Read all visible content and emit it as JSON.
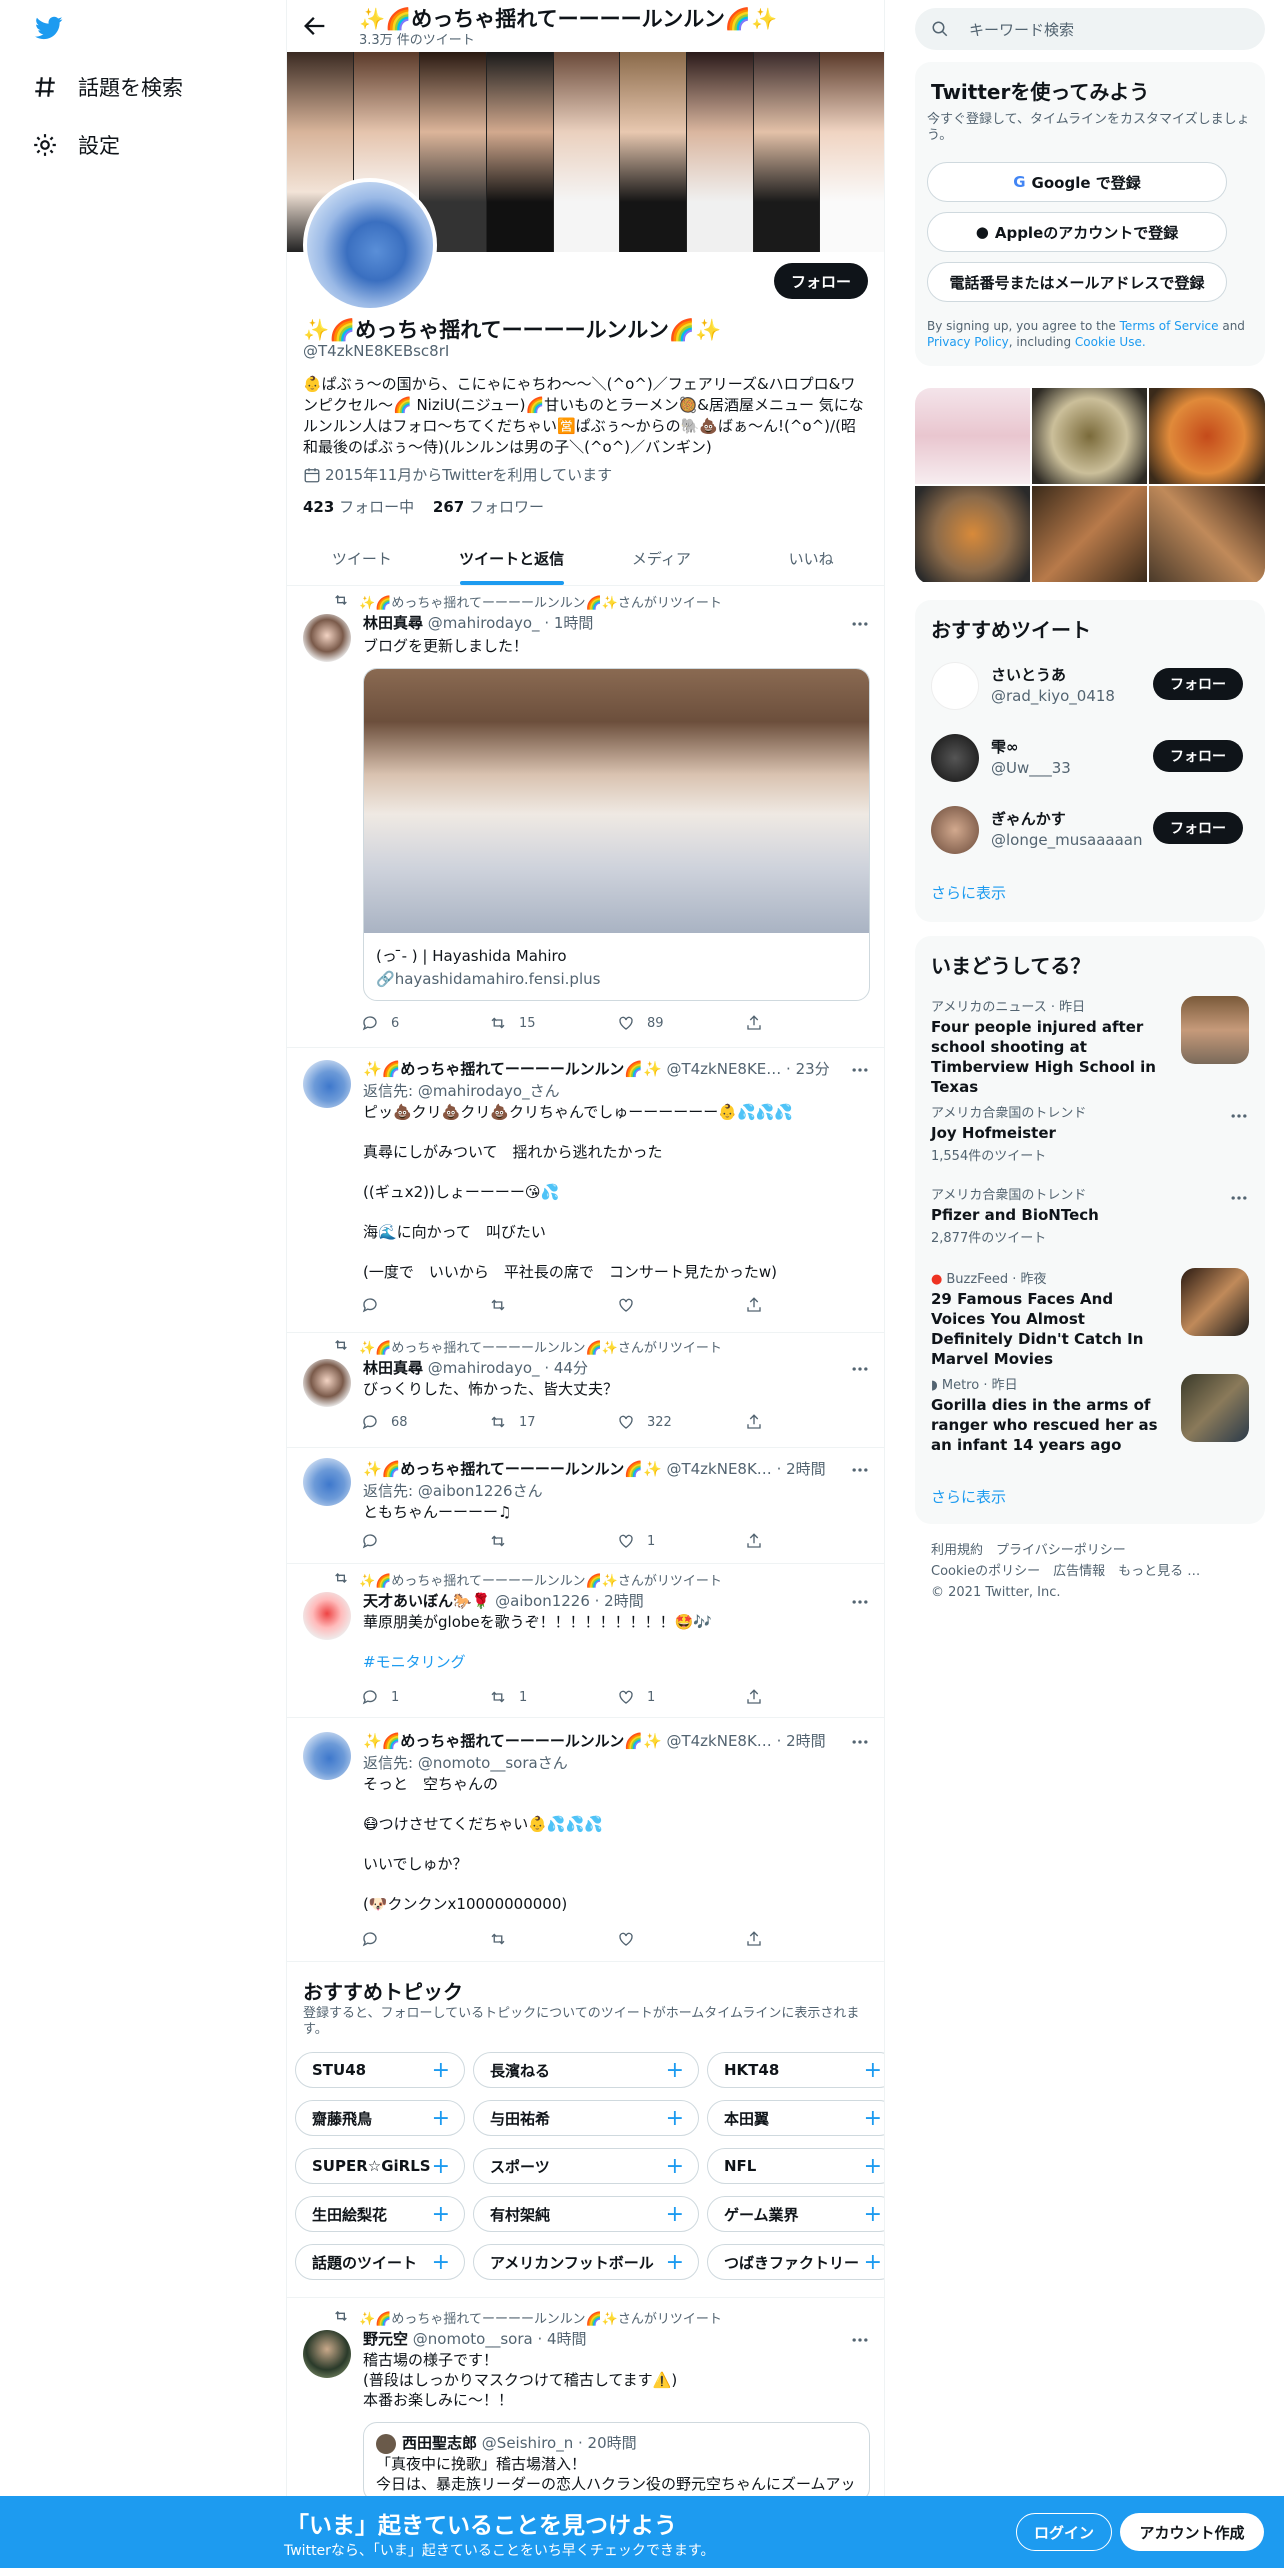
{
  "nav": {
    "explore": "話題を検索",
    "settings": "設定"
  },
  "profile": {
    "name": "✨🌈めっちゃ揺れてーーーールンルン🌈✨",
    "tweet_count": "3.3万 件のツイート",
    "handle": "@T4zkNE8KEBsc8rI",
    "follow": "フォロー",
    "bio": "👶ぱぶぅ〜の国から、こにゃにゃちわ〜〜＼(^o^)／フェアリーズ&ハロプロ&ワンピクセル〜🌈 NiziU(ニジュー)🌈甘いものとラーメン🥘&居酒屋メニュー 気になルンルン人はフォロ〜ちてくだちゃい🈺ぱぶぅ〜からの🐘💩ばぁ〜ん!(^o^)/(昭和最後のぱぶぅ〜侍)(ルンルンは男の子＼(^o^)／バンギン)",
    "joined": "2015年11月からTwitterを利用しています",
    "following_count": "423",
    "following_label": "フォロー中",
    "followers_count": "267",
    "followers_label": "フォロワー"
  },
  "tabs": [
    "ツイート",
    "ツイートと返信",
    "メディア",
    "いいね"
  ],
  "retweet_label": "✨🌈めっちゃ揺れてーーーールンルン🌈✨さんがリツイート",
  "tweets": [
    {
      "name": "林田真尋",
      "meta": "@mahirodayo_ · 1時間",
      "text": "ブログを更新しました！",
      "card_title": "(っ ̄- ) | Hayashida Mahiro",
      "card_url": "hayashidamahiro.fensi.plus",
      "reply": "6",
      "rt": "15",
      "like": "89"
    },
    {
      "name": "✨🌈めっちゃ揺れてーーーールンルン🌈✨",
      "meta": "@T4zkNE8KE… · 23分",
      "reply_to": "返信先: ",
      "reply_handle": "@mahirodayo_",
      "reply_suffix": "さん",
      "text": "ピッ💩クリ💩クリ💩クリちゃんでしゅーーーーーー👶💦💦💦\n\n真尋にしがみついて　揺れから逃れたかった\n\n((ギュx2))しょーーーー😘💦\n\n海🌊に向かって　叫びたい\n\n(一度で　いいから　平社長の席で　コンサート見たかったw)"
    },
    {
      "name": "林田真尋",
      "meta": "@mahirodayo_ · 44分",
      "text": "びっくりした、怖かった、皆大丈夫？",
      "reply": "68",
      "rt": "17",
      "like": "322"
    },
    {
      "name": "✨🌈めっちゃ揺れてーーーールンルン🌈✨",
      "meta": "@T4zkNE8K… · 2時間",
      "reply_to": "返信先: ",
      "reply_handle": "@aibon1226",
      "reply_suffix": "さん",
      "text": "ともちゃんーーーー♫",
      "like": "1"
    },
    {
      "name": "天才あいぼん🐎🌹",
      "meta": "@aibon1226 · 2時間",
      "text": "華原朋美がglobeを歌うぞ！！！！！！！！！🤩🎶",
      "hashtag": "#モニタリング",
      "reply": "1",
      "rt": "1",
      "like": "1"
    },
    {
      "name": "✨🌈めっちゃ揺れてーーーールンルン🌈✨",
      "meta": "@T4zkNE8K… · 2時間",
      "reply_to": "返信先: ",
      "reply_handle": "@nomoto__sora",
      "reply_suffix": "さん",
      "text": "そっと　空ちゃんの\n\n😷つけさせてくだちゃい👶💦💦💦\n\nいいでしゅか？\n\n(🐶クンクンx10000000000)"
    },
    {
      "name": "野元空",
      "meta": "@nomoto__sora · 4時間",
      "text": "稽古場の様子です！\n(普段はしっかりマスクつけて稽古してます⚠️)\n本番お楽しみに〜！！",
      "quote_name": "西田聖志郎",
      "quote_meta": "@Seishiro_n · 20時間",
      "quote_text": "「真夜中に挽歌」稽古場潜入！\n今日は、暴走族リーダーの恋人ハクラン役の野元空ちゃんにズームアップ"
    }
  ],
  "topics": {
    "title": "おすすめトピック",
    "subtitle": "登録すると、フォローしているトピックについてのツイートがホームタイムラインに表示されます。",
    "chips": [
      "STU48",
      "長濱ねる",
      "HKT48",
      "齋藤飛鳥",
      "与田祐希",
      "本田翼",
      "SUPER☆GiRLS",
      "スポーツ",
      "NFL",
      "生田絵梨花",
      "有村架純",
      "ゲーム業界",
      "話題のツイート",
      "アメリカンフットボール",
      "つばきファクトリー"
    ]
  },
  "sidebar": {
    "search_placeholder": "キーワード検索",
    "signup_title": "Twitterを使ってみよう",
    "signup_sub": "今すぐ登録して、タイムラインをカスタマイズしましょう。",
    "google": "Google で登録",
    "apple": "Appleのアカウントで登録",
    "phone": "電話番号またはメールアドレスで登録",
    "terms_pre": "By signing up, you agree to the ",
    "terms": "Terms of Service",
    "terms_mid": " and ",
    "privacy": "Privacy Policy",
    "terms_post": ", including ",
    "cookie": "Cookie Use.",
    "rec_title": "おすすめツイート",
    "recs": [
      {
        "name": "さいとうあ",
        "handle": "@rad_kiyo_0418",
        "btn": "フォロー"
      },
      {
        "name": "雫∞",
        "handle": "@Uw___33",
        "btn": "フォロー"
      },
      {
        "name": "ぎゃんかす",
        "handle": "@longe_musaaaaan",
        "btn": "フォロー"
      }
    ],
    "show_more": "さらに表示",
    "trends_title": "いまどうしてる？",
    "trends": [
      {
        "cat": "アメリカのニュース · 昨日",
        "title": "Four people injured after school shooting at Timberview High School in Texas"
      },
      {
        "cat": "アメリカ合衆国のトレンド",
        "title": "Joy Hofmeister",
        "count": "1,554件のツイート"
      },
      {
        "cat": "アメリカ合衆国のトレンド",
        "title": "Pfizer and BioNTech",
        "count": "2,877件のツイート"
      },
      {
        "cat": "BuzzFeed · 昨夜",
        "title": "29 Famous Faces And Voices You Almost Definitely Didn't Catch In Marvel Movies"
      },
      {
        "cat": "Metro · 昨日",
        "title": "Gorilla dies in the arms of ranger who rescued her as an infant 14 years ago"
      }
    ],
    "footer1": "利用規約　プライバシーポリシー",
    "footer2": "Cookieのポリシー　広告情報　もっと見る …",
    "footer3": "© 2021 Twitter, Inc."
  },
  "bottom": {
    "title": "「いま」起きていることを見つけよう",
    "subtitle": "Twitterなら、「いま」起きていることをいち早くチェックできます。",
    "login": "ログイン",
    "signup": "アカウント作成"
  },
  "colors": {
    "accent": "#1d9bf0",
    "text": "#0f1419",
    "muted": "#536471"
  }
}
